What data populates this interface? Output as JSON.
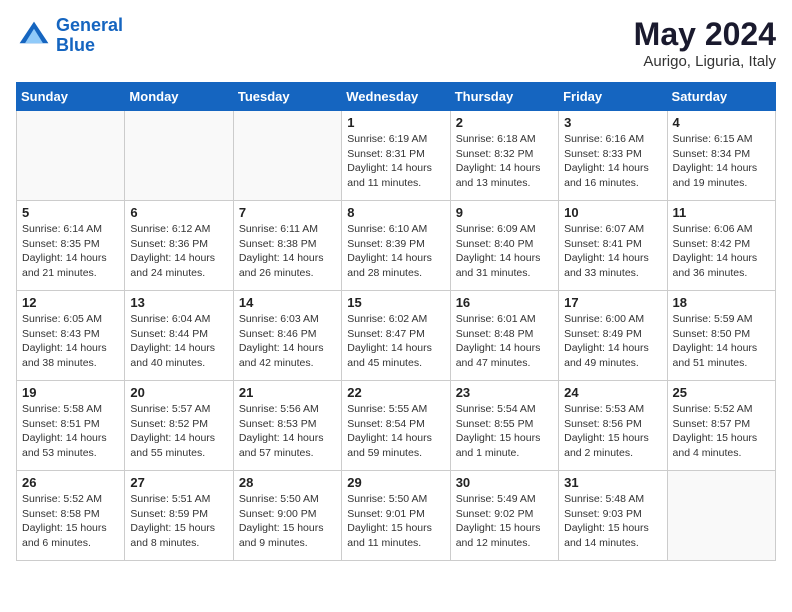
{
  "header": {
    "logo_line1": "General",
    "logo_line2": "Blue",
    "month": "May 2024",
    "location": "Aurigo, Liguria, Italy"
  },
  "weekdays": [
    "Sunday",
    "Monday",
    "Tuesday",
    "Wednesday",
    "Thursday",
    "Friday",
    "Saturday"
  ],
  "weeks": [
    [
      {
        "day": "",
        "info": ""
      },
      {
        "day": "",
        "info": ""
      },
      {
        "day": "",
        "info": ""
      },
      {
        "day": "1",
        "info": "Sunrise: 6:19 AM\nSunset: 8:31 PM\nDaylight: 14 hours\nand 11 minutes."
      },
      {
        "day": "2",
        "info": "Sunrise: 6:18 AM\nSunset: 8:32 PM\nDaylight: 14 hours\nand 13 minutes."
      },
      {
        "day": "3",
        "info": "Sunrise: 6:16 AM\nSunset: 8:33 PM\nDaylight: 14 hours\nand 16 minutes."
      },
      {
        "day": "4",
        "info": "Sunrise: 6:15 AM\nSunset: 8:34 PM\nDaylight: 14 hours\nand 19 minutes."
      }
    ],
    [
      {
        "day": "5",
        "info": "Sunrise: 6:14 AM\nSunset: 8:35 PM\nDaylight: 14 hours\nand 21 minutes."
      },
      {
        "day": "6",
        "info": "Sunrise: 6:12 AM\nSunset: 8:36 PM\nDaylight: 14 hours\nand 24 minutes."
      },
      {
        "day": "7",
        "info": "Sunrise: 6:11 AM\nSunset: 8:38 PM\nDaylight: 14 hours\nand 26 minutes."
      },
      {
        "day": "8",
        "info": "Sunrise: 6:10 AM\nSunset: 8:39 PM\nDaylight: 14 hours\nand 28 minutes."
      },
      {
        "day": "9",
        "info": "Sunrise: 6:09 AM\nSunset: 8:40 PM\nDaylight: 14 hours\nand 31 minutes."
      },
      {
        "day": "10",
        "info": "Sunrise: 6:07 AM\nSunset: 8:41 PM\nDaylight: 14 hours\nand 33 minutes."
      },
      {
        "day": "11",
        "info": "Sunrise: 6:06 AM\nSunset: 8:42 PM\nDaylight: 14 hours\nand 36 minutes."
      }
    ],
    [
      {
        "day": "12",
        "info": "Sunrise: 6:05 AM\nSunset: 8:43 PM\nDaylight: 14 hours\nand 38 minutes."
      },
      {
        "day": "13",
        "info": "Sunrise: 6:04 AM\nSunset: 8:44 PM\nDaylight: 14 hours\nand 40 minutes."
      },
      {
        "day": "14",
        "info": "Sunrise: 6:03 AM\nSunset: 8:46 PM\nDaylight: 14 hours\nand 42 minutes."
      },
      {
        "day": "15",
        "info": "Sunrise: 6:02 AM\nSunset: 8:47 PM\nDaylight: 14 hours\nand 45 minutes."
      },
      {
        "day": "16",
        "info": "Sunrise: 6:01 AM\nSunset: 8:48 PM\nDaylight: 14 hours\nand 47 minutes."
      },
      {
        "day": "17",
        "info": "Sunrise: 6:00 AM\nSunset: 8:49 PM\nDaylight: 14 hours\nand 49 minutes."
      },
      {
        "day": "18",
        "info": "Sunrise: 5:59 AM\nSunset: 8:50 PM\nDaylight: 14 hours\nand 51 minutes."
      }
    ],
    [
      {
        "day": "19",
        "info": "Sunrise: 5:58 AM\nSunset: 8:51 PM\nDaylight: 14 hours\nand 53 minutes."
      },
      {
        "day": "20",
        "info": "Sunrise: 5:57 AM\nSunset: 8:52 PM\nDaylight: 14 hours\nand 55 minutes."
      },
      {
        "day": "21",
        "info": "Sunrise: 5:56 AM\nSunset: 8:53 PM\nDaylight: 14 hours\nand 57 minutes."
      },
      {
        "day": "22",
        "info": "Sunrise: 5:55 AM\nSunset: 8:54 PM\nDaylight: 14 hours\nand 59 minutes."
      },
      {
        "day": "23",
        "info": "Sunrise: 5:54 AM\nSunset: 8:55 PM\nDaylight: 15 hours\nand 1 minute."
      },
      {
        "day": "24",
        "info": "Sunrise: 5:53 AM\nSunset: 8:56 PM\nDaylight: 15 hours\nand 2 minutes."
      },
      {
        "day": "25",
        "info": "Sunrise: 5:52 AM\nSunset: 8:57 PM\nDaylight: 15 hours\nand 4 minutes."
      }
    ],
    [
      {
        "day": "26",
        "info": "Sunrise: 5:52 AM\nSunset: 8:58 PM\nDaylight: 15 hours\nand 6 minutes."
      },
      {
        "day": "27",
        "info": "Sunrise: 5:51 AM\nSunset: 8:59 PM\nDaylight: 15 hours\nand 8 minutes."
      },
      {
        "day": "28",
        "info": "Sunrise: 5:50 AM\nSunset: 9:00 PM\nDaylight: 15 hours\nand 9 minutes."
      },
      {
        "day": "29",
        "info": "Sunrise: 5:50 AM\nSunset: 9:01 PM\nDaylight: 15 hours\nand 11 minutes."
      },
      {
        "day": "30",
        "info": "Sunrise: 5:49 AM\nSunset: 9:02 PM\nDaylight: 15 hours\nand 12 minutes."
      },
      {
        "day": "31",
        "info": "Sunrise: 5:48 AM\nSunset: 9:03 PM\nDaylight: 15 hours\nand 14 minutes."
      },
      {
        "day": "",
        "info": ""
      }
    ]
  ]
}
